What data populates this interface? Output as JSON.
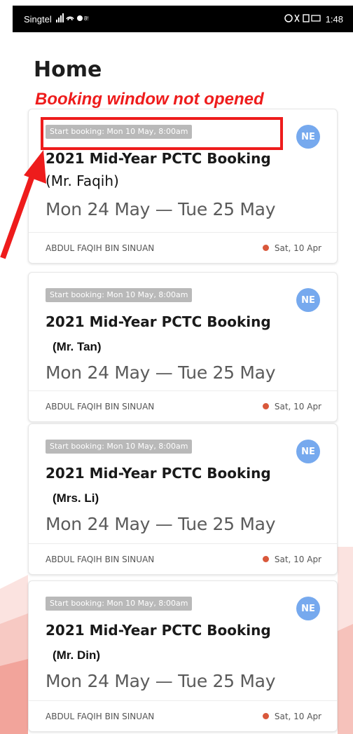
{
  "status_bar": {
    "carrier": "Singtel",
    "signal_text": "📶 ᯤ ✽ ⁸⁹",
    "right_icons": "⏰ ✱ ▯",
    "battery": "▭",
    "time": "1:48"
  },
  "page": {
    "title": "Home"
  },
  "annotation": {
    "text": "Booking window not opened"
  },
  "bookings": [
    {
      "start_chip": "Start booking: Mon 10 May, 8:00am",
      "badge": "NE",
      "title": "2021 Mid-Year PCTC Booking",
      "tutor": "(Mr. Faqih)",
      "dates": "Mon 24 May — Tue 25 May",
      "organizer": "ABDUL FAQIH BIN SINUAN",
      "date_posted": "Sat, 10 Apr"
    },
    {
      "start_chip": "Start booking: Mon 10 May, 8:00am",
      "badge": "NE",
      "title": "2021 Mid-Year PCTC Booking",
      "tutor": "(Mr. Tan)",
      "dates": "Mon 24 May — Tue 25 May",
      "organizer": "ABDUL FAQIH BIN SINUAN",
      "date_posted": "Sat, 10 Apr"
    },
    {
      "start_chip": "Start booking: Mon 10 May, 8:00am",
      "badge": "NE",
      "title": "2021 Mid-Year PCTC Booking",
      "tutor": "(Mrs. Li)",
      "dates": "Mon 24 May — Tue 25 May",
      "organizer": "ABDUL FAQIH BIN SINUAN",
      "date_posted": "Sat, 10 Apr"
    },
    {
      "start_chip": "Start booking: Mon 10 May, 8:00am",
      "badge": "NE",
      "title": "2021 Mid-Year PCTC Booking",
      "tutor": "(Mr. Din)",
      "dates": "Mon 24 May — Tue 25 May",
      "organizer": "ABDUL FAQIH BIN SINUAN",
      "date_posted": "Sat, 10 Apr"
    }
  ],
  "colors": {
    "annotation_red": "#ee1c1c",
    "badge_blue": "#76a9ee",
    "chip_grey": "#b9b9b9",
    "status_dot": "#d9583b"
  }
}
